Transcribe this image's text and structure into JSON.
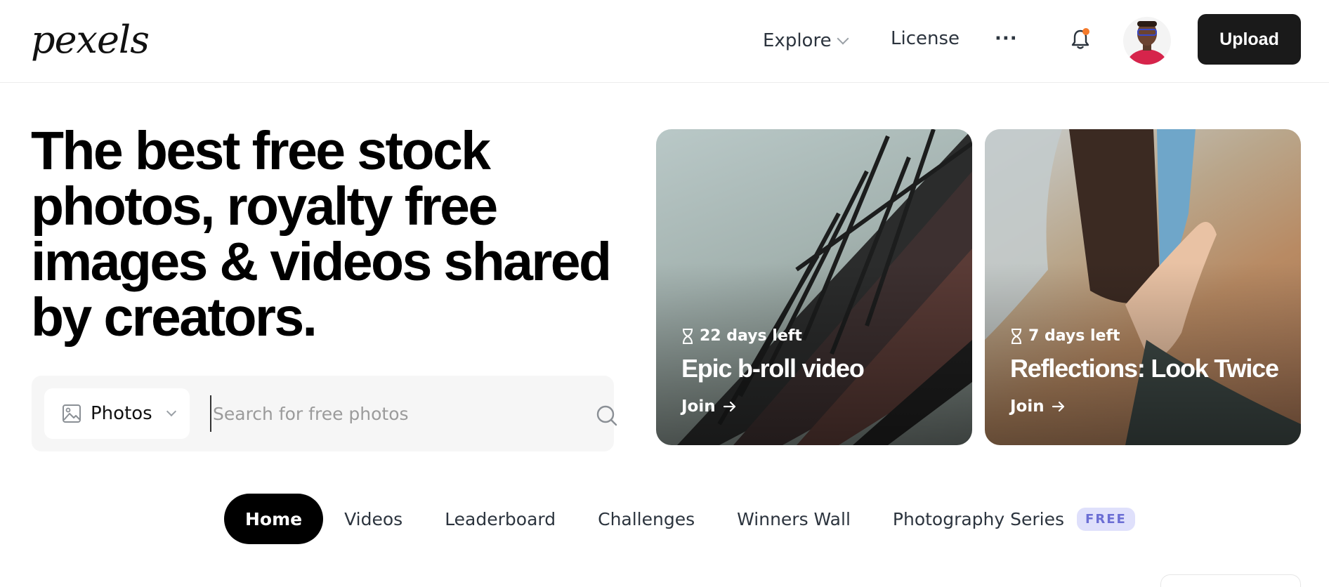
{
  "header": {
    "logo": "pexels",
    "nav": {
      "explore": "Explore",
      "license": "License",
      "more": "···"
    },
    "upload_label": "Upload"
  },
  "hero": {
    "title": "The best free stock photos, royalty free images & videos shared by creators."
  },
  "search": {
    "type_selected": "Photos",
    "placeholder": "Search for free photos",
    "value": ""
  },
  "challenges": [
    {
      "days_left": "22 days left",
      "title": "Epic b-roll video",
      "cta": "Join"
    },
    {
      "days_left": "7 days left",
      "title": "Reflections: Look Twice",
      "cta": "Join"
    }
  ],
  "tabs": [
    {
      "label": "Home",
      "active": true
    },
    {
      "label": "Videos"
    },
    {
      "label": "Leaderboard"
    },
    {
      "label": "Challenges"
    },
    {
      "label": "Winners Wall"
    },
    {
      "label": "Photography Series",
      "badge": "FREE"
    }
  ],
  "colors": {
    "upload_bg": "#1a1a1a",
    "notification_dot": "#f47a2b",
    "free_badge_bg": "#dfe0fb",
    "free_badge_text": "#6b6ed4"
  },
  "icons": {
    "image_icon": "image-icon",
    "search_icon": "search-icon",
    "bell_icon": "bell-icon",
    "hourglass_icon": "hourglass-icon",
    "arrow_icon": "arrow-right-icon"
  }
}
